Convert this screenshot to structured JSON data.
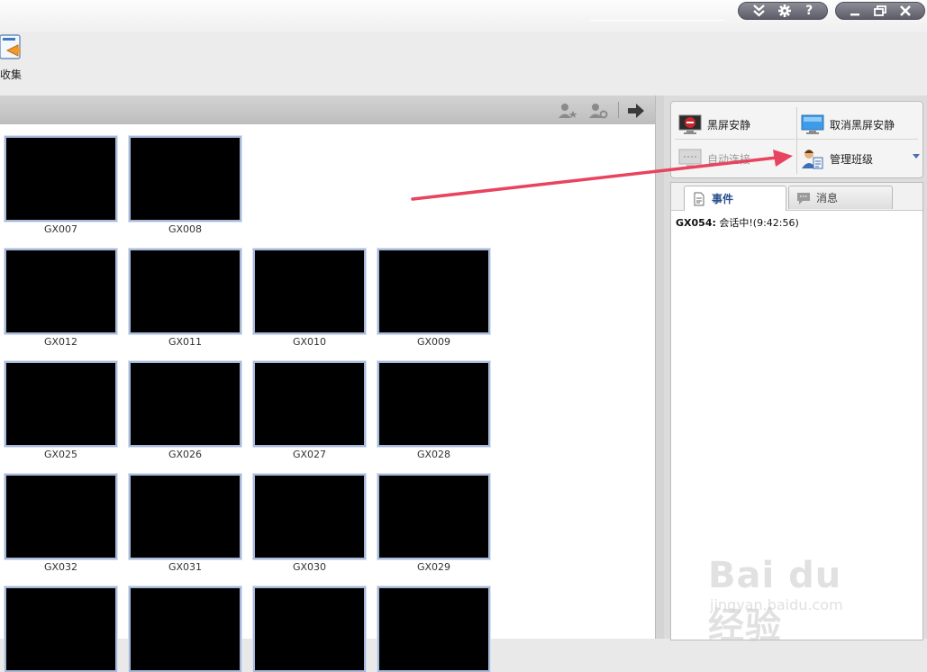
{
  "window_controls": {
    "left_group": [
      "collapse-icon",
      "gear-icon",
      "help-icon"
    ],
    "right_group": [
      "minimize-icon",
      "restore-icon",
      "close-icon"
    ],
    "help_glyph": "?"
  },
  "toolbar": {
    "collect_label": "收集"
  },
  "monitor": {
    "rows": [
      [
        "GX007",
        "GX008"
      ],
      [
        "GX012",
        "GX011",
        "GX010",
        "GX009"
      ],
      [
        "GX025",
        "GX026",
        "GX027",
        "GX028"
      ],
      [
        "GX032",
        "GX031",
        "GX030",
        "GX029"
      ],
      [
        "",
        "",
        "",
        ""
      ]
    ]
  },
  "controls": {
    "black_screen": "黑屏安静",
    "cancel_black_screen": "取消黑屏安静",
    "auto_connect": "自动连接",
    "manage_class": "管理班级"
  },
  "tabs": {
    "events": "事件",
    "messages": "消息"
  },
  "events": {
    "items": [
      {
        "who": "GX054:",
        "text": " 会话中!(9:42:56)"
      }
    ]
  },
  "watermark": {
    "brand": "Bai du 经验",
    "url": "jingyan.baidu.com"
  },
  "colors": {
    "annotation_arrow": "#e8435f",
    "tab_active_text": "#2a4f8f",
    "thumb_border": "#a8b8d8"
  }
}
